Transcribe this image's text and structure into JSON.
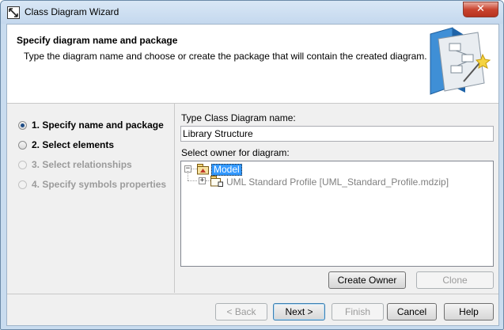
{
  "window": {
    "title": "Class Diagram Wizard",
    "close_glyph": "✕"
  },
  "header": {
    "title": "Specify diagram name and package",
    "description": "Type the diagram name and choose or create the package that will contain the created diagram."
  },
  "steps": [
    {
      "label": "1. Specify name and package",
      "selected": true,
      "enabled": true
    },
    {
      "label": "2. Select elements",
      "selected": false,
      "enabled": true
    },
    {
      "label": "3. Select relationships",
      "selected": false,
      "enabled": false
    },
    {
      "label": "4. Specify symbols properties",
      "selected": false,
      "enabled": false
    }
  ],
  "form": {
    "name_label": "Type Class Diagram name:",
    "name_value": "Library Structure",
    "owner_label": "Select owner for diagram:"
  },
  "tree": {
    "nodes": [
      {
        "label": "Model",
        "expander": "−",
        "selected": true
      },
      {
        "label": "UML Standard Profile [UML_Standard_Profile.mdzip]",
        "expander": "+",
        "selected": false
      }
    ]
  },
  "buttons": {
    "create_owner": "Create Owner",
    "clone": "Clone",
    "back": "< Back",
    "next": "Next >",
    "finish": "Finish",
    "cancel": "Cancel",
    "help": "Help"
  },
  "colors": {
    "selection": "#3399ff",
    "title_bar": "#c4d8ee",
    "close_button": "#c9442f"
  },
  "icons": [
    "class-diagram-app-icon",
    "wizard-illustration",
    "package-icon",
    "profile-package-icon",
    "close-icon"
  ]
}
